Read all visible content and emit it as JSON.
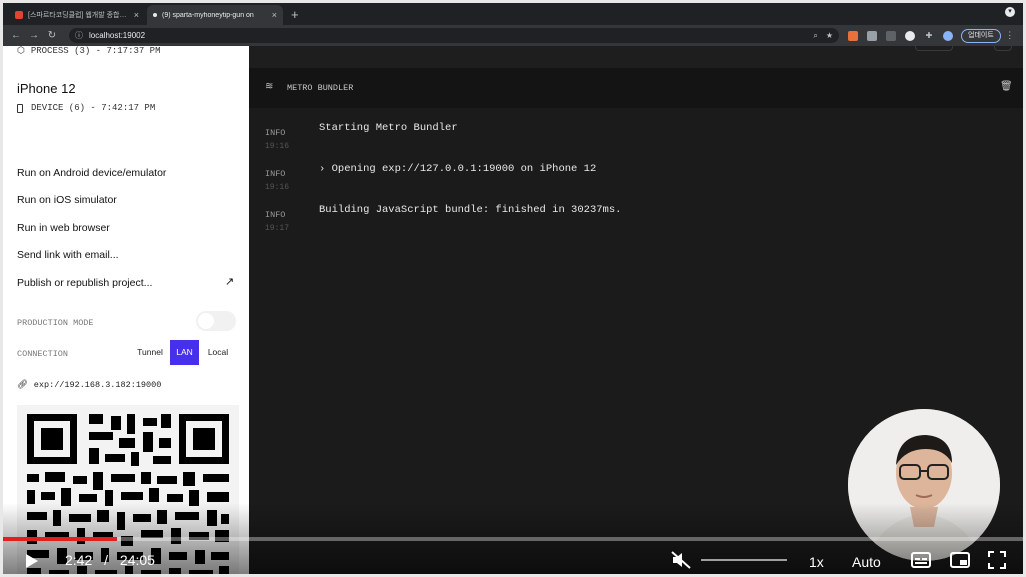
{
  "browser": {
    "tabs": [
      {
        "title": "[스파르타코딩클럽] 웹개발 종합반 -",
        "close": "×",
        "active": false
      },
      {
        "title": "(9) sparta-myhoneytip-gun on",
        "close": "×",
        "active": true
      }
    ],
    "new_tab": "+",
    "address": "localhost:19002",
    "update_button": "업데이트",
    "colors": {
      "tabbar": "#202124",
      "toolbar": "#35363a"
    }
  },
  "sidebar": {
    "process_line": "PROCESS (3) - 7:17:37 PM",
    "device_name": "iPhone 12",
    "device_line": "DEVICE (6) - 7:42:17 PM",
    "menu": [
      "Run on Android device/emulator",
      "Run on iOS simulator",
      "Run in web browser",
      "Send link with email...",
      "Publish or republish project..."
    ],
    "production_mode_label": "PRODUCTION MODE",
    "production_mode_on": false,
    "connection_label": "CONNECTION",
    "connection_options": [
      "Tunnel",
      "LAN",
      "Local"
    ],
    "connection_selected": "LAN",
    "exp_url": "exp://192.168.3.182:19000",
    "accent": "#4630eb"
  },
  "logs": {
    "title": "METRO BUNDLER",
    "entries": [
      {
        "level": "INFO",
        "time": "19:16",
        "message": "Starting Metro Bundler"
      },
      {
        "level": "INFO",
        "time": "19:16",
        "message": "› Opening exp://127.0.0.1:19000 on iPhone 12"
      },
      {
        "level": "INFO",
        "time": "19:17",
        "message": "Building JavaScript bundle: finished in 30237ms."
      }
    ]
  },
  "player": {
    "current_time": "2:42",
    "separator": "/",
    "duration": "24:05",
    "progress": 0.112,
    "speed": "1x",
    "quality": "Auto",
    "muted": true,
    "accent": "#e02020"
  }
}
